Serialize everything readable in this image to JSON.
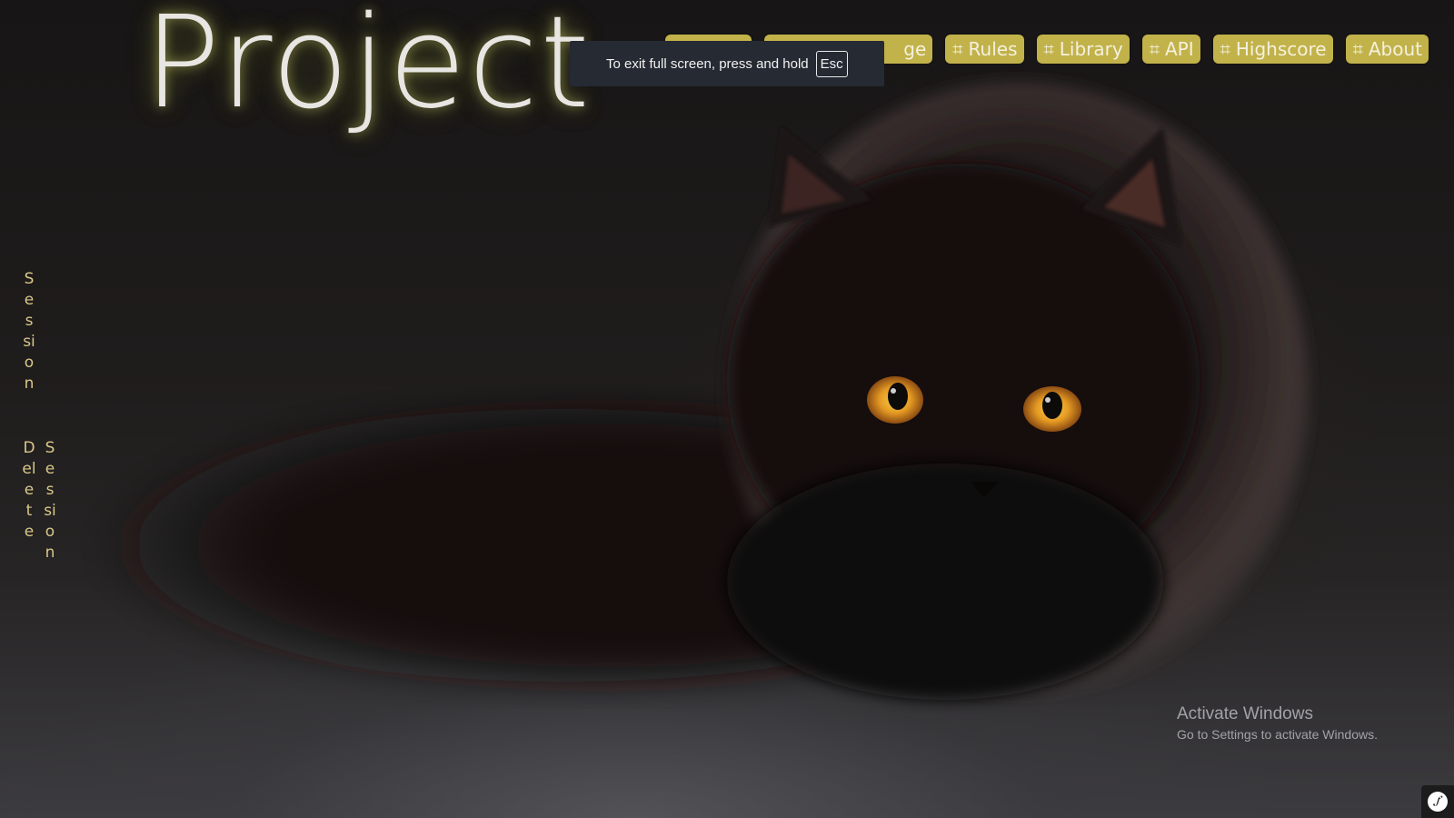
{
  "page": {
    "title": "Project"
  },
  "nav": {
    "items": [
      {
        "label": "Rules"
      },
      {
        "label": "Library"
      },
      {
        "label": "API"
      },
      {
        "label": "Highscore"
      },
      {
        "label": "About"
      }
    ],
    "hidden_partial_suffix": "ge"
  },
  "fullscreen_toast": {
    "text": "To exit full screen, press and hold",
    "key": "Esc"
  },
  "sidebar": {
    "session_label": "Session",
    "delete_label": "Delete",
    "delete_session_label": "Session"
  },
  "watermark": {
    "title": "Activate Windows",
    "subtitle": "Go to Settings to activate Windows."
  },
  "colors": {
    "nav_button_bg": "#c2b24a",
    "sidebar_text": "#d9c88a",
    "toast_bg": "#252a33"
  },
  "icons": {
    "nav": "hash-icon",
    "badge": "symfony-icon"
  }
}
